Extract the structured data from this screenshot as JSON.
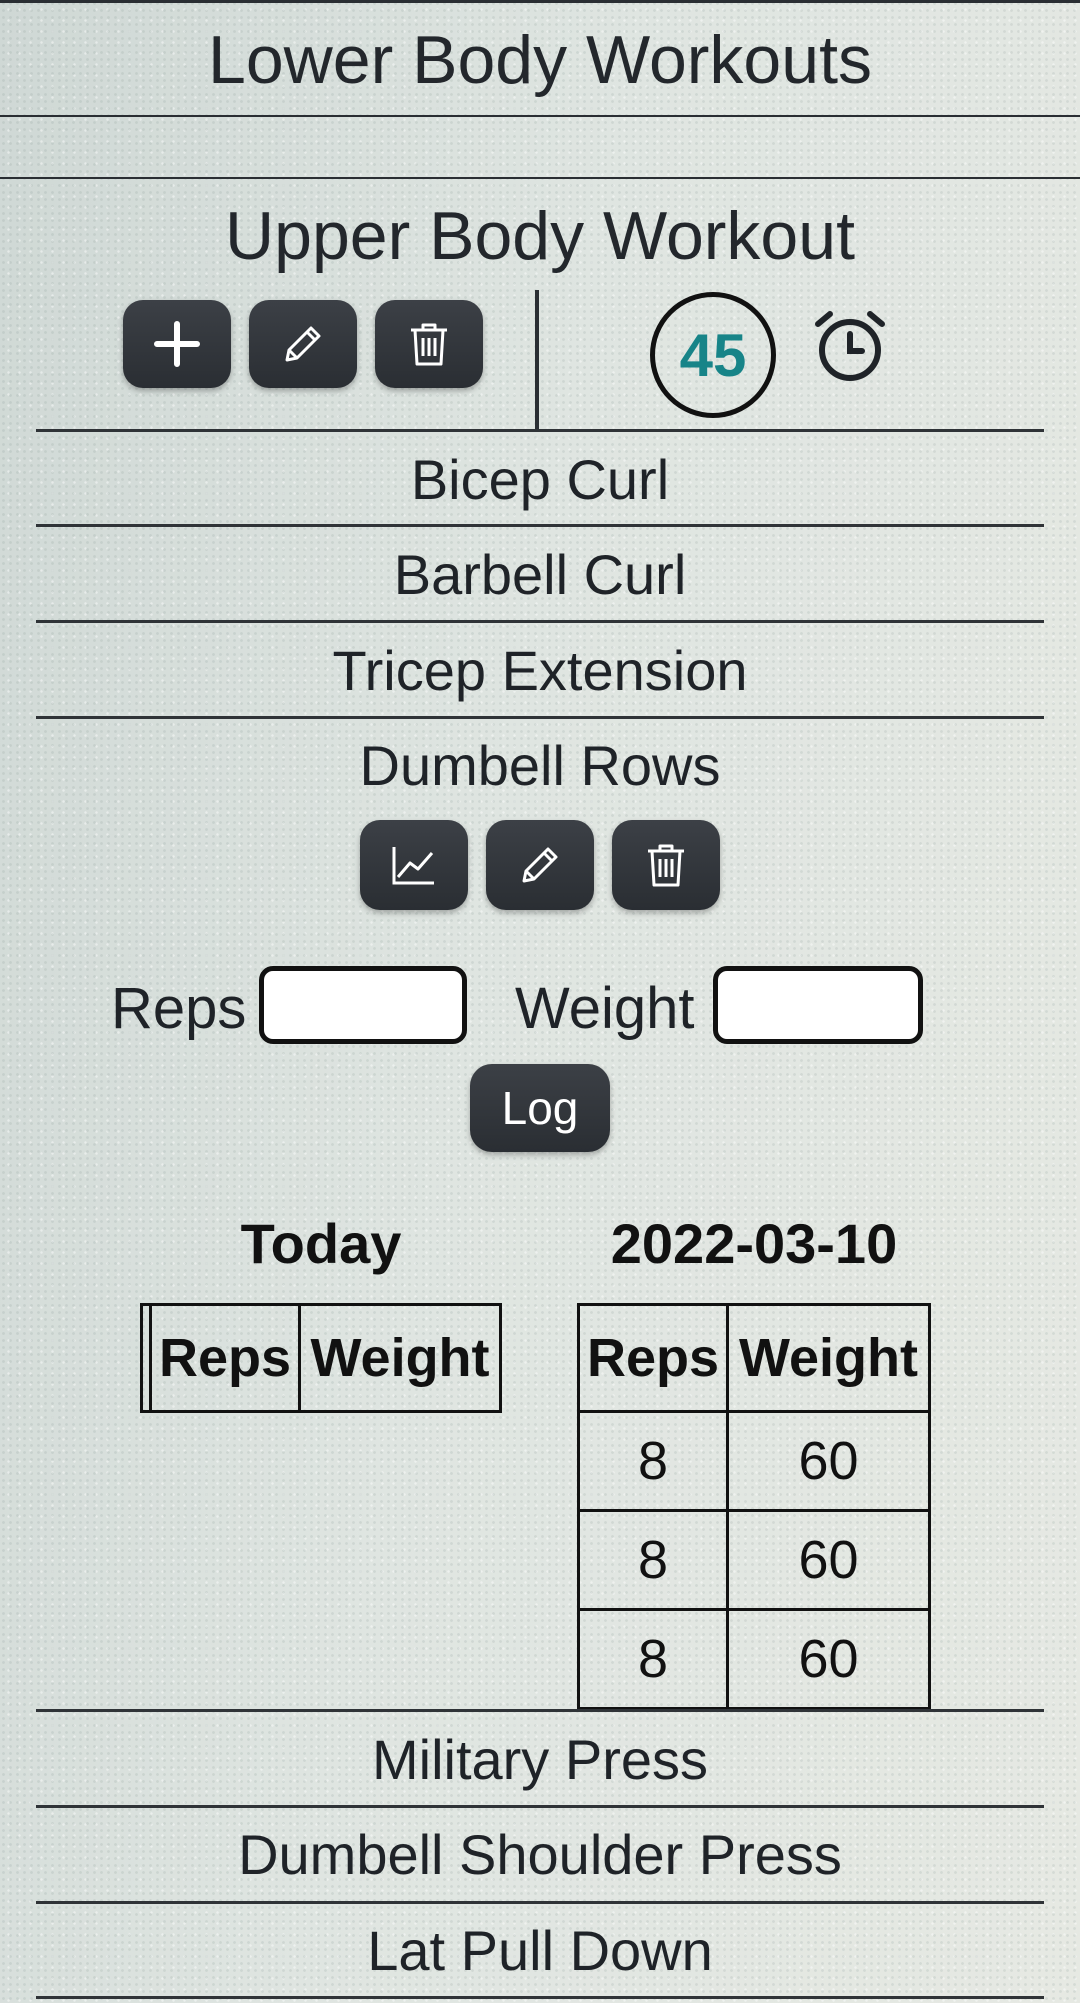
{
  "header": {
    "title": "Lower Body Workouts"
  },
  "workout": {
    "title": "Upper Body Workout",
    "timer_value": "45"
  },
  "icons": {
    "add": "plus-icon",
    "edit": "pencil-icon",
    "delete": "trash-icon",
    "timer": "alarm-clock-icon",
    "chart": "line-chart-icon"
  },
  "exercises": [
    {
      "name": "Bicep Curl"
    },
    {
      "name": "Barbell Curl"
    },
    {
      "name": "Tricep Extension"
    },
    {
      "name": "Dumbell Rows"
    },
    {
      "name": "Military Press"
    },
    {
      "name": "Dumbell Shoulder Press"
    },
    {
      "name": "Lat Pull Down"
    }
  ],
  "log_form": {
    "reps_label": "Reps",
    "weight_label": "Weight",
    "reps_value": "",
    "weight_value": "",
    "log_label": "Log"
  },
  "history": {
    "today": {
      "title": "Today",
      "columns": [
        "Reps",
        "Weight"
      ],
      "rows": []
    },
    "previous": {
      "title": "2022-03-10",
      "columns": [
        "Reps",
        "Weight"
      ],
      "rows": [
        {
          "reps": "8",
          "weight": "60"
        },
        {
          "reps": "8",
          "weight": "60"
        },
        {
          "reps": "8",
          "weight": "60"
        }
      ]
    }
  },
  "colors": {
    "button_bg": "#31353b",
    "timer_text": "#178488",
    "rule": "#2f3337"
  }
}
